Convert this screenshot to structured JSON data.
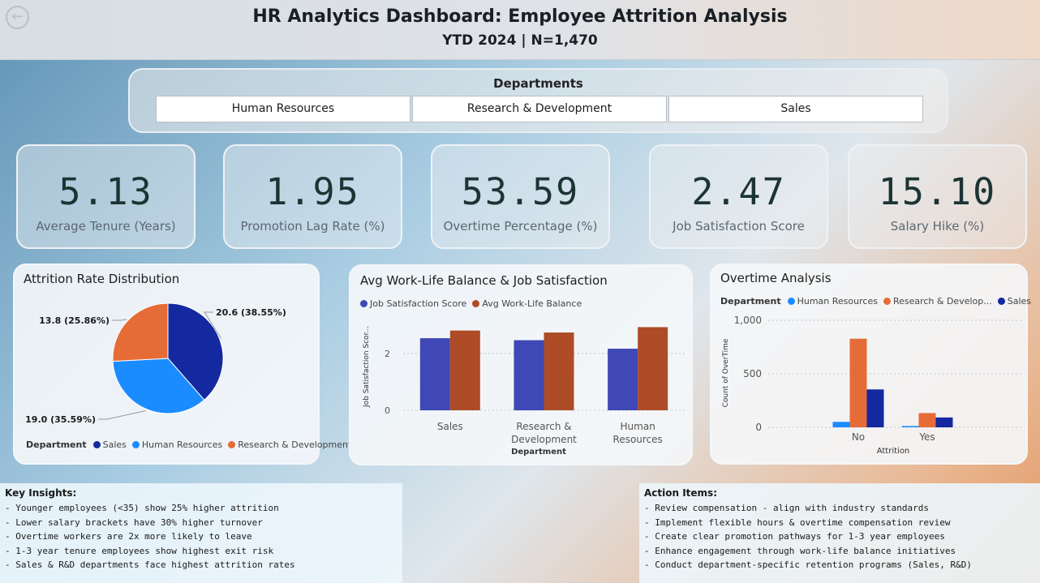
{
  "header": {
    "title": "HR Analytics Dashboard: Employee Attrition Analysis",
    "subtitle": "YTD 2024 | N=1,470",
    "back_icon": "arrow-left-icon"
  },
  "departments": {
    "title": "Departments",
    "options": [
      "Human Resources",
      "Research & Development",
      "Sales"
    ]
  },
  "kpis": [
    {
      "value": "5.13",
      "label": "Average Tenure (Years)"
    },
    {
      "value": "1.95",
      "label": "Promotion Lag Rate (%)"
    },
    {
      "value": "53.59",
      "label": "Overtime Percentage (%)"
    },
    {
      "value": "2.47",
      "label": "Job Satisfaction Score"
    },
    {
      "value": "15.10",
      "label": "Salary Hike (%)"
    }
  ],
  "colors": {
    "navy": "#1428a0",
    "blue": "#1a8cff",
    "orange": "#e66c37",
    "indigo": "#3f48b4",
    "rust": "#ad4c26"
  },
  "chart_data": [
    {
      "type": "pie",
      "title": "Attrition Rate Distribution",
      "legend_title": "Department",
      "slices": [
        {
          "name": "Sales",
          "value": 20.6,
          "label": "20.6 (38.55%)",
          "color": "#1428a0"
        },
        {
          "name": "Human Resources",
          "value": 19.0,
          "label": "19.0 (35.59%)",
          "color": "#1a8cff"
        },
        {
          "name": "Research & Development",
          "value": 13.8,
          "label": "13.8 (25.86%)",
          "color": "#e66c37"
        }
      ],
      "legend_position": "bottom-left"
    },
    {
      "type": "bar",
      "title": "Avg Work-Life Balance & Job Satisfaction",
      "xlabel": "Department",
      "ylabel": "Job Satisfaction Scor...",
      "categories": [
        "Sales",
        "Research & Development",
        "Human Resources"
      ],
      "category_lines": [
        [
          "Sales"
        ],
        [
          "Research &",
          "Development"
        ],
        [
          "Human",
          "Resources"
        ]
      ],
      "series": [
        {
          "name": "Job Satisfaction Score",
          "values": [
            2.54,
            2.47,
            2.17
          ],
          "color": "#3f48b4"
        },
        {
          "name": "Avg Work-Life Balance",
          "values": [
            2.81,
            2.74,
            2.93
          ],
          "color": "#ad4c26"
        }
      ],
      "yticks": [
        0,
        2
      ],
      "ylim": [
        0,
        3.2
      ],
      "grid": true,
      "legend_position": "top-left"
    },
    {
      "type": "bar",
      "title": "Overtime Analysis",
      "legend_title": "Department",
      "xlabel": "Attrition",
      "ylabel": "Count of OverTime",
      "categories": [
        "No",
        "Yes"
      ],
      "series": [
        {
          "name": "Human Resources",
          "values": [
            51,
            12
          ],
          "color": "#1a8cff"
        },
        {
          "name": "Research & Develop...",
          "values": [
            828,
            133
          ],
          "color": "#e66c37"
        },
        {
          "name": "Sales",
          "values": [
            354,
            92
          ],
          "color": "#1428a0"
        }
      ],
      "yticks": [
        0,
        500,
        1000
      ],
      "ytick_labels": [
        "0",
        "500",
        "1,000"
      ],
      "ylim": [
        0,
        1000
      ],
      "grid": true,
      "legend_position": "top-left"
    }
  ],
  "insights": {
    "title": "Key Insights:",
    "items": [
      "- Younger employees (<35) show 25% higher attrition",
      "- Lower salary brackets have 30% higher turnover",
      "- Overtime workers are 2x more likely to leave",
      "- 1-3 year tenure employees show highest exit risk",
      "- Sales & R&D departments face highest attrition rates"
    ]
  },
  "actions": {
    "title": "Action Items:",
    "items": [
      "- Review compensation - align with industry standards",
      "- Implement flexible hours & overtime compensation review",
      "- Create clear promotion pathways for 1-3 year employees",
      "- Enhance engagement through work-life balance initiatives",
      "- Conduct department-specific retention programs (Sales, R&D)"
    ]
  }
}
